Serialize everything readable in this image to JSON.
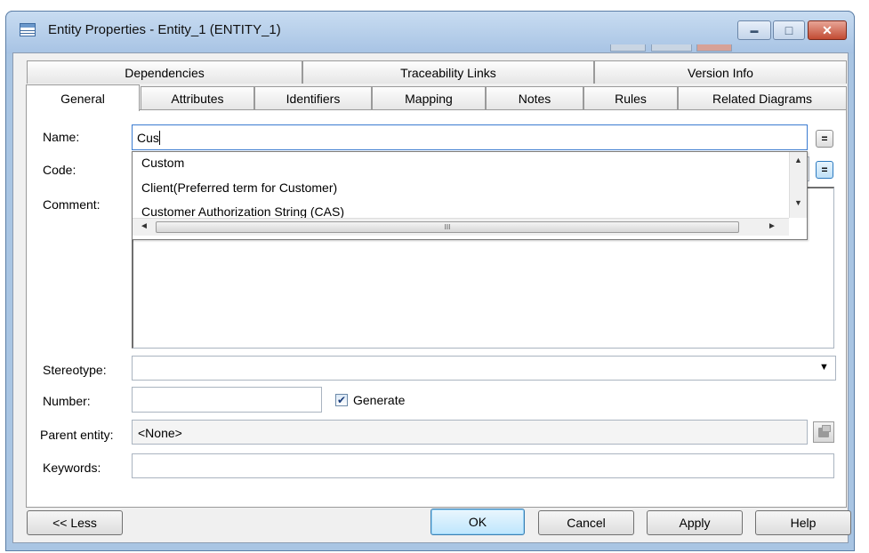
{
  "window": {
    "title": "Entity Properties - Entity_1 (ENTITY_1)",
    "min_glyph": "▬",
    "max_glyph": "□",
    "close_glyph": "✕"
  },
  "tabs_row1": [
    "Dependencies",
    "Traceability Links",
    "Version Info"
  ],
  "tabs_row2": [
    "General",
    "Attributes",
    "Identifiers",
    "Mapping",
    "Notes",
    "Rules",
    "Related Diagrams"
  ],
  "form": {
    "name_label": "Name:",
    "name_value": "Cus",
    "code_label": "Code:",
    "comment_label": "Comment:",
    "equals_glyph": "=",
    "stereotype_label": "Stereotype:",
    "stereotype_value": "",
    "number_label": "Number:",
    "number_value": "",
    "generate_label": "Generate",
    "generate_checked": true,
    "check_glyph": "✔",
    "parent_label": "Parent entity:",
    "parent_value": "<None>",
    "keywords_label": "Keywords:",
    "keywords_value": ""
  },
  "autocomplete": {
    "items": [
      "Custom",
      "Client(Preferred term for Customer)",
      "Customer Authorization String (CAS)"
    ],
    "scroll_up": "▲",
    "scroll_down": "▼",
    "scroll_left": "◄",
    "scroll_right": "►",
    "thumb_glyph": "III"
  },
  "icons": {
    "dropdown_arrow": "▼"
  },
  "buttons": {
    "less": "<< Less",
    "ok": "OK",
    "cancel": "Cancel",
    "apply": "Apply",
    "help": "Help"
  },
  "colors": {
    "title_bar": "#a7c3e4",
    "close_button": "#c24b33",
    "focus_border": "#3b7bd0",
    "default_button": "#bee6fd"
  }
}
